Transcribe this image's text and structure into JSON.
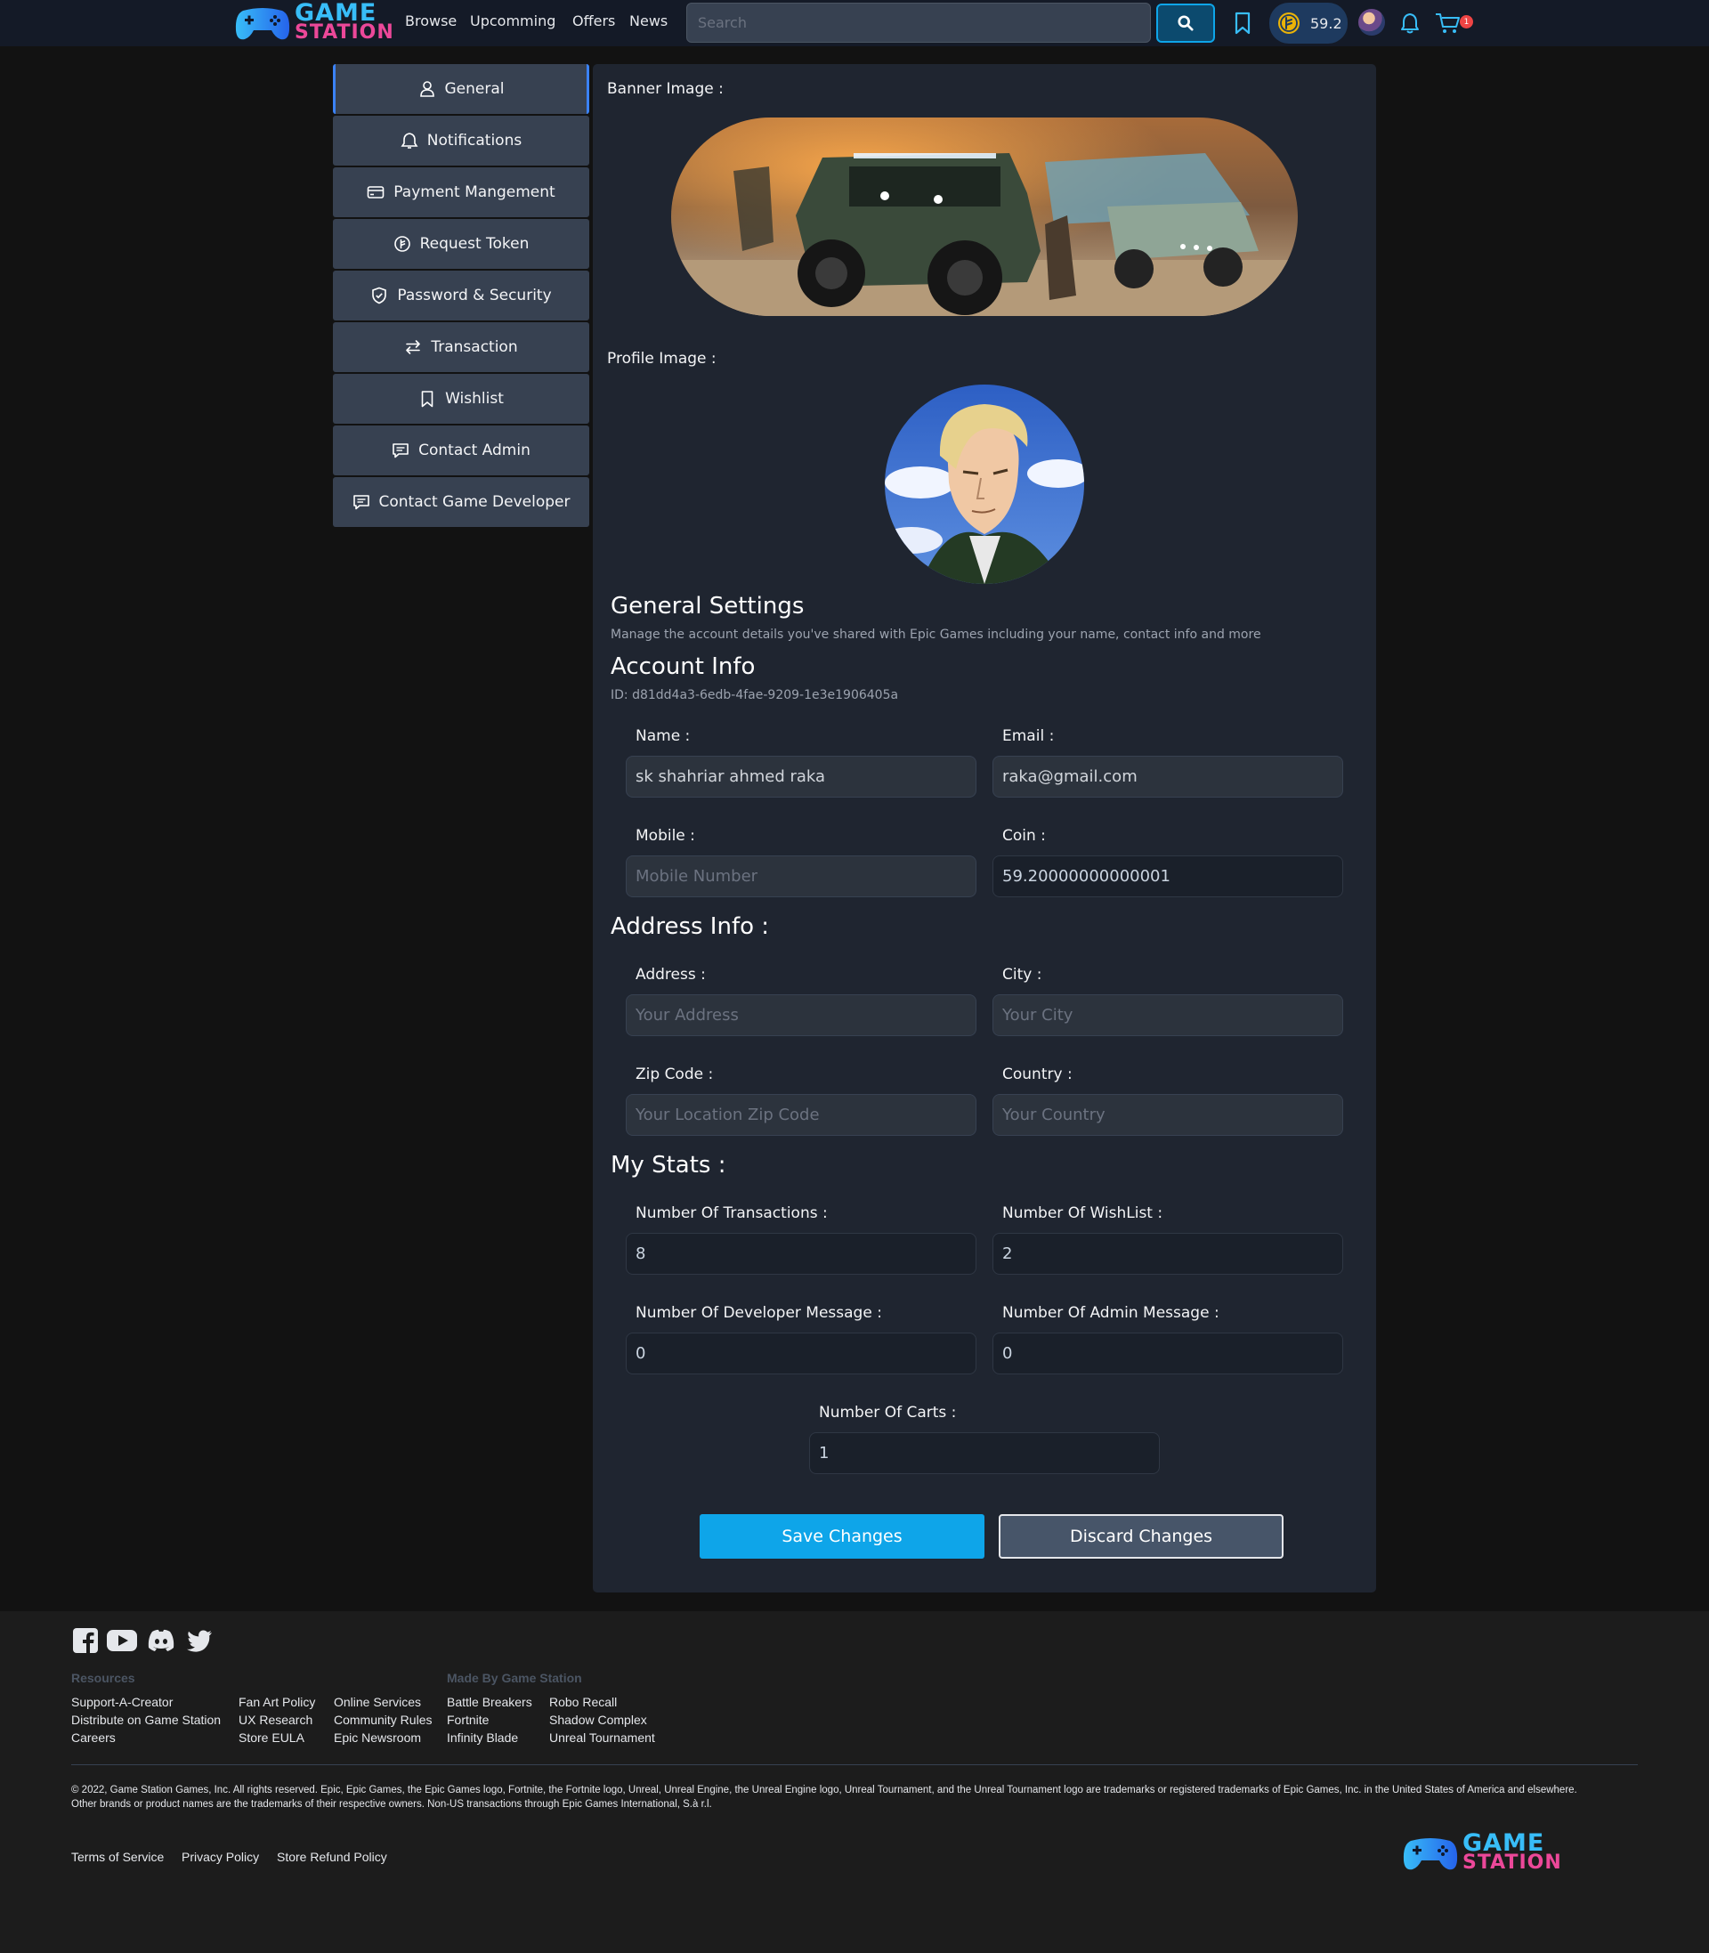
{
  "nav": {
    "logo_line1": "GAME",
    "logo_line2": "STATION",
    "links": [
      "Browse",
      "Upcomming",
      "Offers",
      "News"
    ],
    "search_placeholder": "Search",
    "coin_value": "59.2",
    "cart_count": "1",
    "icons": [
      "search-icon",
      "bookmark-icon",
      "coin-icon",
      "avatar",
      "bell-icon",
      "cart-icon"
    ]
  },
  "sidebar": {
    "items": [
      {
        "label": "General",
        "icon": "user-icon",
        "active": true
      },
      {
        "label": "Notifications",
        "icon": "bell-icon"
      },
      {
        "label": "Payment Mangement",
        "icon": "credit-card-icon"
      },
      {
        "label": "Request Token",
        "icon": "coin-icon"
      },
      {
        "label": "Password & Security",
        "icon": "shield-icon"
      },
      {
        "label": "Transaction",
        "icon": "exchange-arrows-icon"
      },
      {
        "label": "Wishlist",
        "icon": "bookmark-icon"
      },
      {
        "label": "Contact Admin",
        "icon": "message-icon"
      },
      {
        "label": "Contact Game Developer",
        "icon": "message-icon"
      }
    ]
  },
  "main": {
    "banner_label": "Banner Image :",
    "profile_label": "Profile Image :",
    "general_title": "General Settings",
    "general_desc": "Manage the account details you've shared with Epic Games including your name, contact info and more",
    "account_title": "Account Info",
    "account_id": "ID: d81dd4a3-6edb-4fae-9209-1e3e1906405a",
    "fields": {
      "name": {
        "label": "Name :",
        "value": "sk shahriar ahmed raka"
      },
      "email": {
        "label": "Email :",
        "value": "raka@gmail.com"
      },
      "mobile": {
        "label": "Mobile :",
        "placeholder": "Mobile Number"
      },
      "coin": {
        "label": "Coin :",
        "value": "59.20000000000001"
      }
    },
    "address_title": "Address Info :",
    "address": {
      "address": {
        "label": "Address :",
        "placeholder": "Your Address"
      },
      "city": {
        "label": "City :",
        "placeholder": "Your City"
      },
      "zip": {
        "label": "Zip Code :",
        "placeholder": "Your Location Zip Code"
      },
      "country": {
        "label": "Country :",
        "placeholder": "Your Country"
      }
    },
    "stats_title": "My Stats :",
    "stats": {
      "transactions": {
        "label": "Number Of Transactions :",
        "value": "8"
      },
      "wishlist": {
        "label": "Number Of WishList :",
        "value": "2"
      },
      "dev_msg": {
        "label": "Number Of Developer Message :",
        "value": "0"
      },
      "admin_msg": {
        "label": "Number Of Admin Message :",
        "value": "0"
      },
      "carts": {
        "label": "Number Of Carts :",
        "value": "1"
      }
    },
    "save_label": "Save Changes",
    "discard_label": "Discard Changes"
  },
  "footer": {
    "social": [
      "facebook-icon",
      "youtube-icon",
      "discord-icon",
      "twitter-icon"
    ],
    "resources_head": "Resources",
    "made_by_head": "Made By Game Station",
    "col1": [
      "Support-A-Creator",
      "Distribute on Game Station",
      "Careers"
    ],
    "col2": [
      "Fan Art Policy",
      "UX Research",
      "Store EULA"
    ],
    "col3": [
      "Online Services",
      "Community Rules",
      "Epic Newsroom"
    ],
    "col4": [
      "Battle Breakers",
      "Fortnite",
      "Infinity Blade"
    ],
    "col5": [
      "Robo Recall",
      "Shadow Complex",
      "Unreal Tournament"
    ],
    "legal": "© 2022, Game Station Games, Inc. All rights reserved. Epic, Epic Games, the Epic Games logo, Fortnite, the Fortnite logo, Unreal, Unreal Engine, the Unreal Engine logo, Unreal Tournament, and the Unreal Tournament logo are trademarks or registered trademarks of Epic Games, Inc. in the United States of America and elsewhere. Other brands or product names are the trademarks of their respective owners. Non-US transactions through Epic Games International, S.à r.l.",
    "bottom_links": [
      "Terms of Service",
      "Privacy Policy",
      "Store Refund Policy"
    ],
    "logo_line1": "GAME",
    "logo_line2": "STATION"
  }
}
